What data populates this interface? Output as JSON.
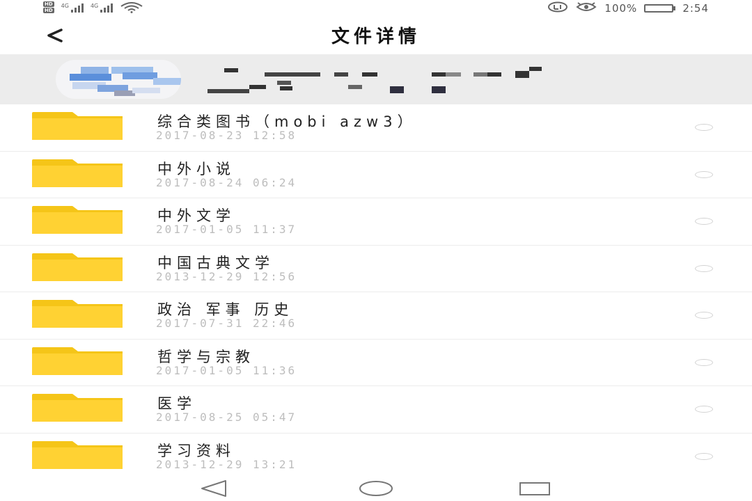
{
  "status_bar": {
    "hd_badges": [
      "HD",
      "HD"
    ],
    "signal_1_label": "4G",
    "signal_2_label": "4G",
    "battery_percent": "100%",
    "time": "2:54",
    "icons": [
      "hd-icon",
      "signal-icon",
      "wifi-icon",
      "nfc-icon",
      "eye-comfort-icon",
      "battery-icon"
    ]
  },
  "header": {
    "title": "文件详情",
    "back_icon": "back-arrow-icon"
  },
  "account": {
    "avatar_icon": "avatar",
    "name_redacted": true
  },
  "colors": {
    "folder": "#ffd233",
    "folder_tab": "#f5c518",
    "date_text": "#bdbdbd",
    "divider": "#ececec",
    "banner_bg": "#ececec"
  },
  "files": [
    {
      "name": "综合类图书（mobi azw3）",
      "date": "2017-08-23  12:58"
    },
    {
      "name": "中外小说",
      "date": "2017-08-24  06:24"
    },
    {
      "name": "中外文学",
      "date": "2017-01-05  11:37"
    },
    {
      "name": "中国古典文学",
      "date": "2013-12-29  12:56"
    },
    {
      "name": "政治 军事 历史",
      "date": "2017-07-31  22:46"
    },
    {
      "name": "哲学与宗教",
      "date": "2017-01-05  11:36"
    },
    {
      "name": "医学",
      "date": "2017-08-25  05:47"
    },
    {
      "name": "学习资料",
      "date": "2013-12-29  13:21"
    }
  ],
  "nav_bar": {
    "icons": [
      "nav-back-icon",
      "nav-home-icon",
      "nav-recents-icon"
    ]
  }
}
